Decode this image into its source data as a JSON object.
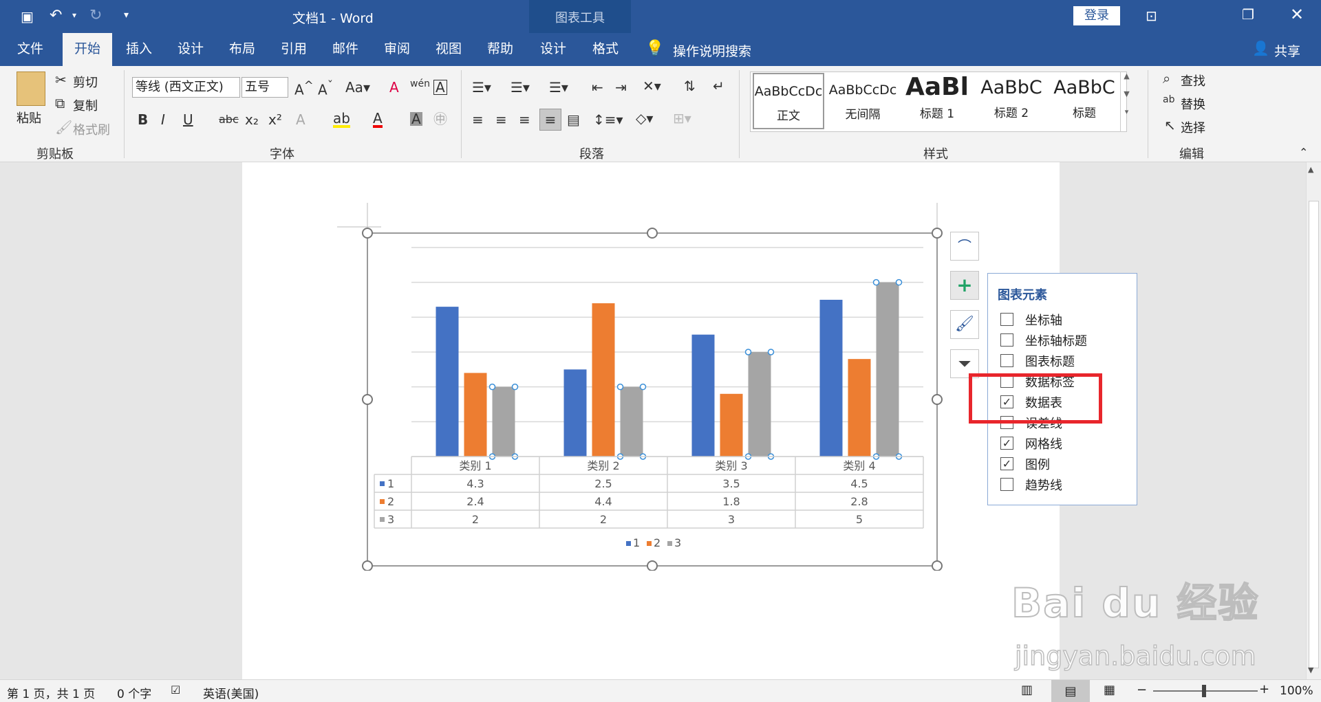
{
  "window": {
    "doc_title": "文档1  -  Word",
    "context_tab_group": "图表工具",
    "login": "登录"
  },
  "tabs": [
    "文件",
    "开始",
    "插入",
    "设计",
    "布局",
    "引用",
    "邮件",
    "审阅",
    "视图",
    "帮助",
    "设计",
    "格式"
  ],
  "tell_me": "操作说明搜索",
  "share": "共享",
  "clipboard": {
    "paste": "粘贴",
    "cut": "剪切",
    "copy": "复制",
    "format_painter": "格式刷",
    "label": "剪贴板"
  },
  "font": {
    "name": "等线 (西文正文)",
    "size": "五号",
    "label": "字体"
  },
  "paragraph": {
    "label": "段落"
  },
  "styles": {
    "items": [
      {
        "preview": "AaBbCcDc",
        "name": "正文"
      },
      {
        "preview": "AaBbCcDc",
        "name": "无间隔"
      },
      {
        "preview": "AaBl",
        "name": "标题 1"
      },
      {
        "preview": "AaBbC",
        "name": "标题 2"
      },
      {
        "preview": "AaBbC",
        "name": "标题"
      }
    ],
    "label": "样式"
  },
  "editing": {
    "find": "查找",
    "replace": "替换",
    "select": "选择",
    "label": "编辑"
  },
  "chart_data": {
    "type": "bar",
    "categories": [
      "类别 1",
      "类别 2",
      "类别 3",
      "类别 4"
    ],
    "series": [
      {
        "name": "1",
        "values": [
          4.3,
          2.5,
          3.5,
          4.5
        ],
        "color": "#4472c4"
      },
      {
        "name": "2",
        "values": [
          2.4,
          4.4,
          1.8,
          2.8
        ],
        "color": "#ed7d31"
      },
      {
        "name": "3",
        "values": [
          2,
          2,
          3,
          5
        ],
        "color": "#a5a5a5"
      }
    ],
    "ylim": [
      0,
      6
    ],
    "grid": true,
    "data_table": true,
    "legend": "bottom"
  },
  "chart_elements": {
    "title": "图表元素",
    "items": [
      {
        "label": "坐标轴",
        "checked": false
      },
      {
        "label": "坐标轴标题",
        "checked": false
      },
      {
        "label": "图表标题",
        "checked": false
      },
      {
        "label": "数据标签",
        "checked": false
      },
      {
        "label": "数据表",
        "checked": true
      },
      {
        "label": "误差线",
        "checked": false
      },
      {
        "label": "网格线",
        "checked": true
      },
      {
        "label": "图例",
        "checked": true
      },
      {
        "label": "趋势线",
        "checked": false
      }
    ],
    "highlight_color": "#e8262c"
  },
  "status": {
    "page": "第 1 页，共 1 页",
    "words": "0 个字",
    "language": "英语(美国)",
    "zoom": "100%"
  },
  "watermark": {
    "brand": "Bai du 经验",
    "url": "jingyan.baidu.com"
  }
}
